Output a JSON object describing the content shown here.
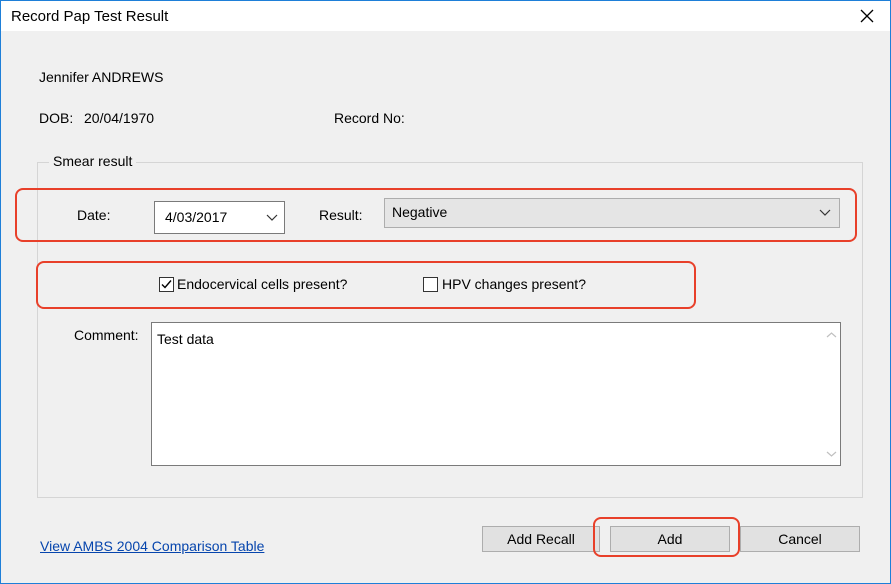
{
  "window": {
    "title": "Record Pap Test Result"
  },
  "patient": {
    "name": "Jennifer ANDREWS",
    "dob_label": "DOB:",
    "dob_value": "20/04/1970",
    "record_label": "Record No:"
  },
  "smear": {
    "group_label": "Smear result",
    "date_label": "Date:",
    "date_value": "4/03/2017",
    "result_label": "Result:",
    "result_value": "Negative",
    "endocervical_label": "Endocervical cells present?",
    "endocervical_checked": true,
    "hpv_label": "HPV changes present?",
    "hpv_checked": false,
    "comment_label": "Comment:",
    "comment_value": "Test data"
  },
  "footer": {
    "link_label": "View AMBS 2004 Comparison Table",
    "add_recall_label": "Add Recall",
    "add_label": "Add",
    "cancel_label": "Cancel"
  },
  "icons": {
    "close": "close-icon",
    "dropdown": "chevron-down-icon",
    "check": "checkmark-icon",
    "scroll_up": "scroll-up-icon",
    "scroll_down": "scroll-down-icon"
  },
  "colors": {
    "highlight": "#e8402a",
    "link": "#0645ad",
    "window_border": "#1e7fd8",
    "dialog_bg": "#f0f0f0"
  }
}
